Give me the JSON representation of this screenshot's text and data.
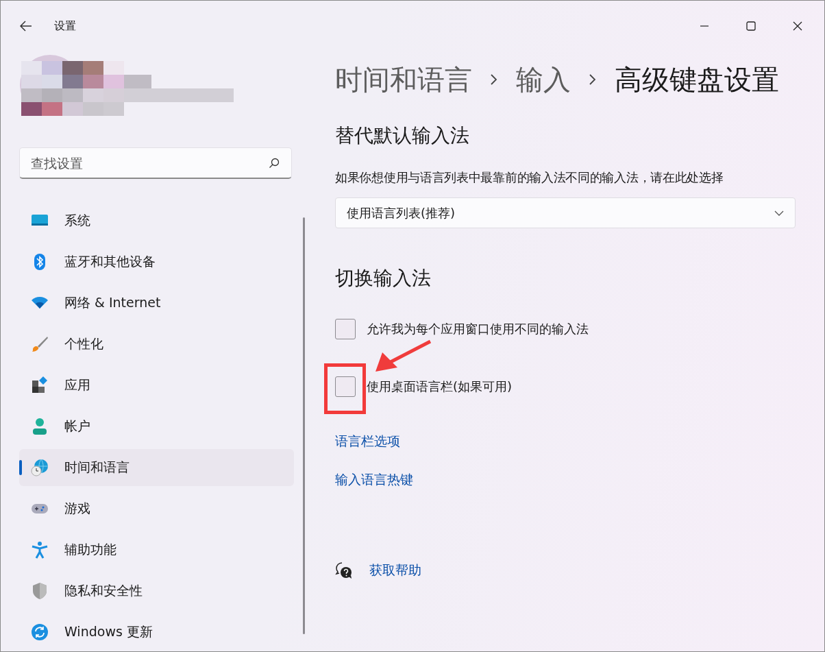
{
  "window": {
    "title": "设置"
  },
  "search": {
    "placeholder": "查找设置"
  },
  "sidebar": {
    "items": [
      {
        "label": "系统",
        "selected": false
      },
      {
        "label": "蓝牙和其他设备",
        "selected": false
      },
      {
        "label": "网络 & Internet",
        "selected": false
      },
      {
        "label": "个性化",
        "selected": false
      },
      {
        "label": "应用",
        "selected": false
      },
      {
        "label": "帐户",
        "selected": false
      },
      {
        "label": "时间和语言",
        "selected": true
      },
      {
        "label": "游戏",
        "selected": false
      },
      {
        "label": "辅助功能",
        "selected": false
      },
      {
        "label": "隐私和安全性",
        "selected": false
      },
      {
        "label": "Windows 更新",
        "selected": false
      }
    ]
  },
  "breadcrumb": [
    "时间和语言",
    "输入",
    "高级键盘设置"
  ],
  "override": {
    "heading": "替代默认输入法",
    "description": "如果你想使用与语言列表中最靠前的输入法不同的输入法，请在此处选择",
    "dropdown": {
      "value": "使用语言列表(推荐)"
    }
  },
  "switching": {
    "heading": "切换输入法",
    "checkboxes": [
      {
        "label": "允许我为每个应用窗口使用不同的输入法",
        "checked": false
      },
      {
        "label": "使用桌面语言栏(如果可用)",
        "checked": false
      }
    ],
    "links": [
      "语言栏选项",
      "输入语言热键"
    ]
  },
  "help": {
    "label": "获取帮助"
  }
}
